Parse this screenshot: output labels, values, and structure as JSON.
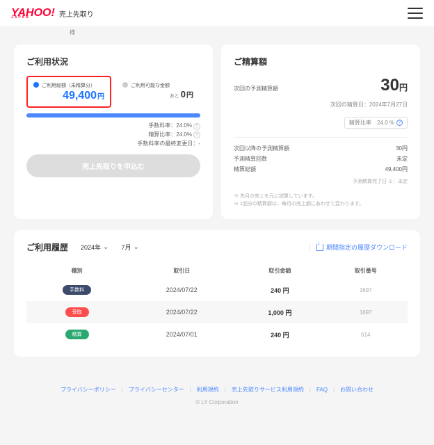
{
  "header": {
    "logo": "YAHOO!",
    "logo_sub": "JAPAN",
    "service": "売上先取り",
    "mini": "様"
  },
  "usage": {
    "title": "ご利用状況",
    "option_active": {
      "label": "ご利用総額（未精算分）",
      "amount": "49,400",
      "unit": "円"
    },
    "option_passive": {
      "label": "ご利用可能な金額",
      "sub": "あと",
      "amount": "0",
      "unit": "円"
    },
    "fee_fee": "手数料率：24.0%",
    "fee_rate": "精算比率：24.0%",
    "fee_change": "手数料率の最終変更日：-",
    "apply_button": "売上先取りを申込む"
  },
  "settlement": {
    "title": "ご精算額",
    "next_label": "次回の予測精算額",
    "amount": "30",
    "unit": "円",
    "date_label": "次回の精算日：2024年7月27日",
    "rate_label": "精算比率",
    "rate_value": "24.0 %",
    "rows": [
      {
        "label": "次回以降の予測精算額",
        "value": "30円"
      },
      {
        "label": "予測精算回数",
        "value": "未定"
      },
      {
        "label": "精算総額",
        "value": "49,400円"
      }
    ],
    "complete_note": "予測精算完了日 ※：未定",
    "notes": [
      "※ 先月の売上を元に試算しています。",
      "※ 1回分の精算額は、毎月の売上額にあわせて変わります。"
    ]
  },
  "history": {
    "title": "ご利用履歴",
    "year": "2024年",
    "month": "7月",
    "download": "期間指定の履歴ダウンロード",
    "columns": {
      "type": "種別",
      "date": "取引日",
      "amount": "取引金額",
      "txid": "取引番号"
    },
    "rows": [
      {
        "tag": "手数料",
        "tag_class": "navy",
        "date": "2024/07/22",
        "amount": "240 円",
        "txid": "1697"
      },
      {
        "tag": "受取",
        "tag_class": "red",
        "date": "2024/07/22",
        "amount": "1,000 円",
        "txid": "1697"
      },
      {
        "tag": "精算",
        "tag_class": "green",
        "date": "2024/07/01",
        "amount": "240 円",
        "txid": "614"
      }
    ]
  },
  "footer": {
    "links": [
      "プライバシーポリシー",
      "プライバシーセンター",
      "利用規約",
      "売上先取りサービス利用規約",
      "FAQ",
      "お問い合わせ"
    ],
    "copyright": "© LY Corporation"
  }
}
